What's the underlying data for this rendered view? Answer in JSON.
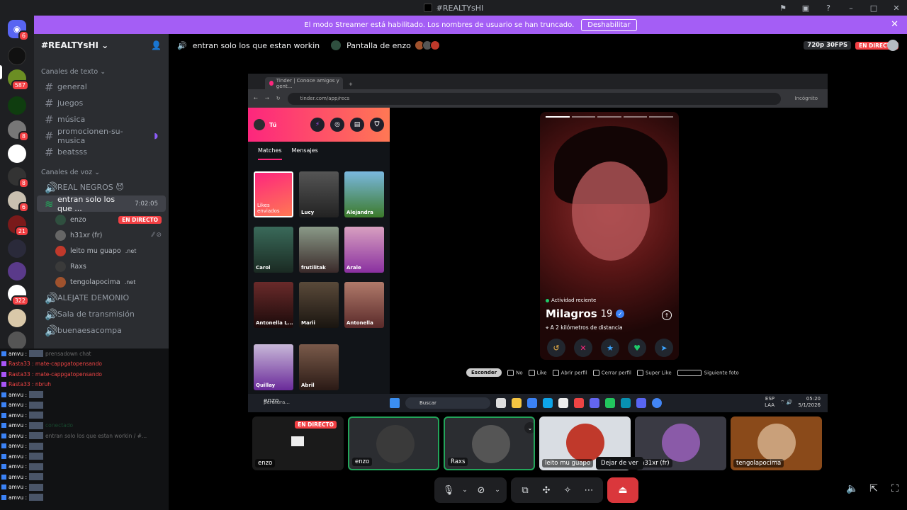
{
  "window": {
    "title": "#REALTYsHI"
  },
  "banner": {
    "text": "El modo Streamer está habilitado. Los nombres de usuario se han truncado.",
    "button": "Deshabilitar"
  },
  "server": {
    "name": "#REALTYsHI",
    "guild_badges": [
      "6",
      "587",
      "8",
      "8",
      "6",
      "21",
      "322"
    ],
    "text_category": "Canales de texto",
    "text_channels": [
      "general",
      "juegos",
      "música",
      "promocionen-su-musica",
      "beatsss"
    ],
    "voice_category": "Canales de voz",
    "voice_channels": {
      "real_negros": "REAL NEGROS 😈",
      "active": "entran solo los que ...",
      "active_time": "7:02:05",
      "alejate": "ALEJATE DEMONIO",
      "sala": "Sala de transmisión",
      "buenaesa": "buenaesacompa"
    },
    "voice_users": [
      {
        "name": "enzo",
        "status": "EN DIRECTO"
      },
      {
        "name": "h31xr (fr)",
        "status": ""
      },
      {
        "name": "leito mu guapo",
        "tag": ".net"
      },
      {
        "name": "Raxs",
        "tag": ""
      },
      {
        "name": "tengolapocima",
        "tag": ".net"
      }
    ]
  },
  "chatlog": {
    "lines": [
      "amvu :",
      "Rasta33 : mate-cappgatopensando",
      "Rasta33 : mate-cappgatopensando",
      "Rasta33 : nbruh",
      "amvu :",
      "amvu :",
      "amvu :",
      "amvu :",
      "amvu :",
      "amvu :",
      "amvu :",
      "amvu :",
      "amvu :",
      "amvu :",
      "amvu :"
    ],
    "ghost_texts": [
      "prensadown chat",
      "conectado",
      "entran solo los que estan workin / #..."
    ]
  },
  "header": {
    "channel": "entran solo los que estan workin",
    "screen": "Pantalla de enzo",
    "quality": "720p 30FPS",
    "live": "EN DIRECTO"
  },
  "browser": {
    "tab_title": "Tinder | Conoce amigos y gent...",
    "url": "tinder.com/app/recs",
    "incognito": "Incógnito"
  },
  "tinder": {
    "me_label": "Tú",
    "tabs": [
      "Matches",
      "Mensajes"
    ],
    "likes_label": "Likes enviados",
    "matches": [
      "Lucy",
      "Alejandra",
      "Carol",
      "frutilitak",
      "Arale",
      "Antonella L...",
      "Marii",
      "Antonella",
      "Quillay",
      "Abril"
    ],
    "profile": {
      "activity": "Actividad reciente",
      "name": "Milagros",
      "age": "19",
      "distance": "A 2 kilómetros de distancia"
    },
    "legend": {
      "hide": "Esconder",
      "no": "No",
      "like": "Like",
      "open": "Abrir perfil",
      "close": "Cerrar perfil",
      "superlike": "Super Like",
      "next": "Siguiente foto"
    }
  },
  "taskbar": {
    "search": "Buscar",
    "lang": "ESP",
    "lang2": "LAA",
    "time": "05:20",
    "date": "5/1/2026",
    "weather": "peratura..."
  },
  "stream_owner": "enzo",
  "participants": [
    "enzo",
    "enzo",
    "Raxs",
    "leito mu guapo",
    "h31xr (fr)",
    "tengolapocima"
  ],
  "participant_live": "EN DIRECTO",
  "tooltip": "Dejar de ver",
  "colors": {
    "banner": "#a45ef5",
    "live": "#f23f43",
    "tinder_pink": "#fd267d",
    "leave": "#da373c",
    "speaking": "#23a55a"
  }
}
